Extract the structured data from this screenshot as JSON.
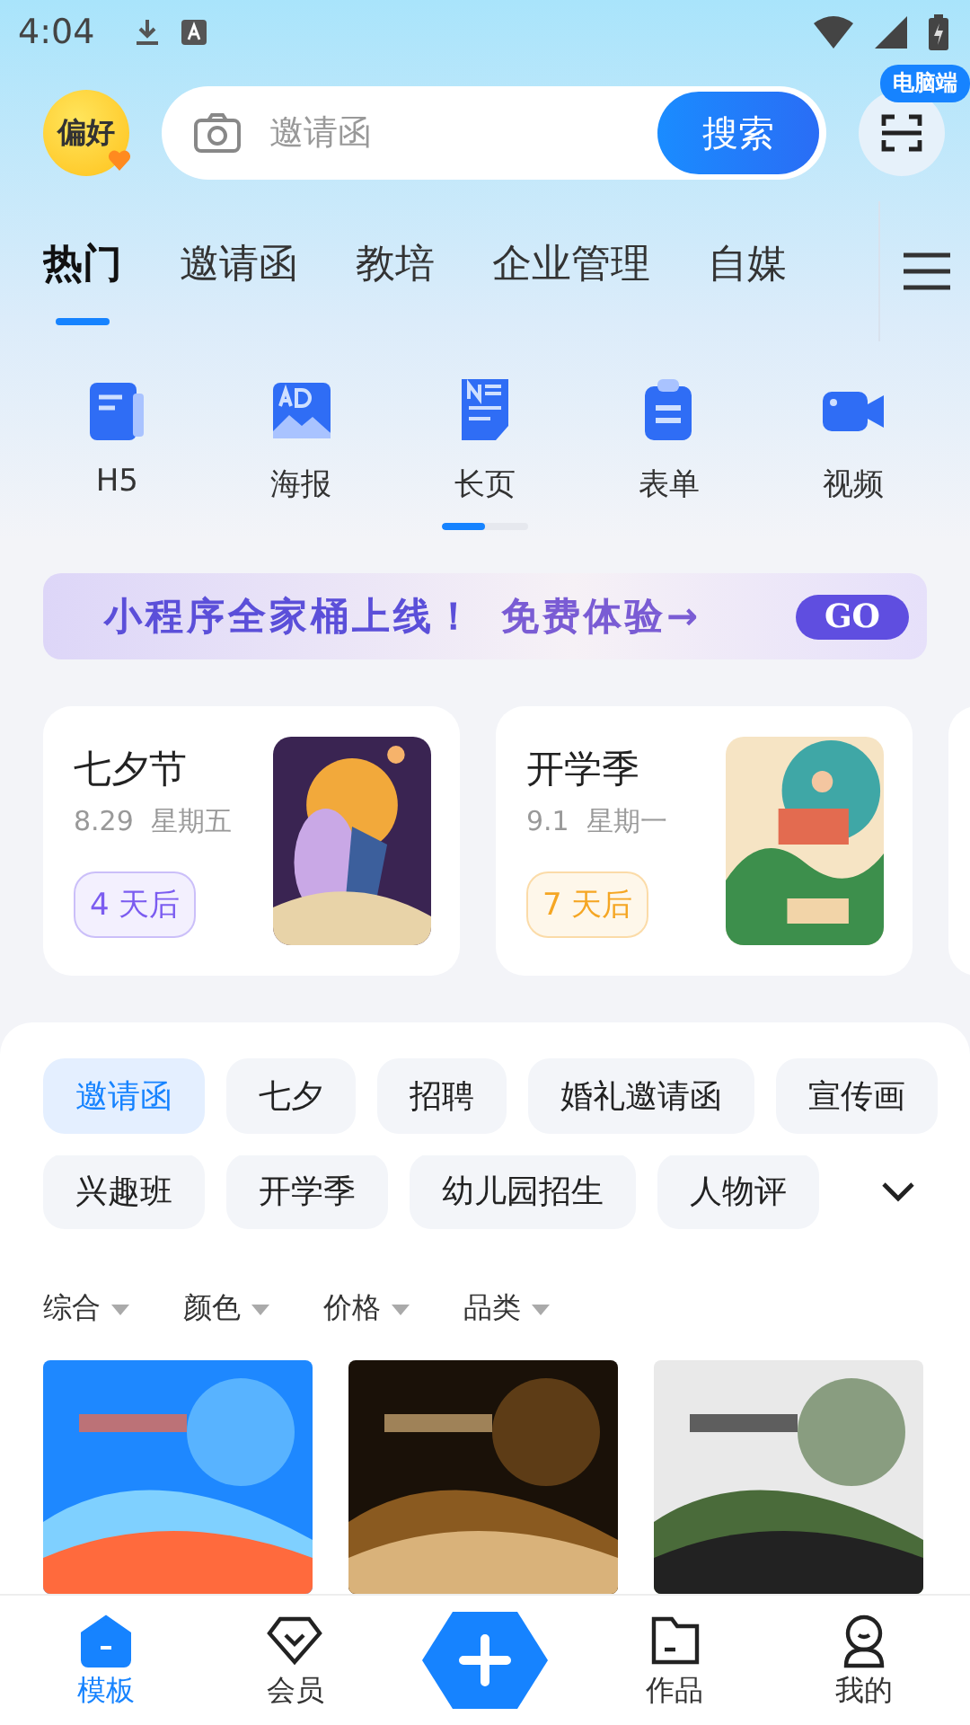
{
  "status_bar": {
    "time": "4:04"
  },
  "header": {
    "avatar_label": "偏好",
    "search": {
      "placeholder": "邀请函",
      "button": "搜索"
    },
    "pc_badge": "电脑端"
  },
  "tabs": [
    {
      "label": "热门",
      "selected": true
    },
    {
      "label": "邀请函",
      "selected": false
    },
    {
      "label": "教培",
      "selected": false
    },
    {
      "label": "企业管理",
      "selected": false
    },
    {
      "label": "自媒",
      "selected": false
    }
  ],
  "types": [
    {
      "kind": "h5",
      "label": "H5"
    },
    {
      "kind": "poster",
      "label": "海报"
    },
    {
      "kind": "longpage",
      "label": "长页"
    },
    {
      "kind": "form",
      "label": "表单"
    },
    {
      "kind": "video",
      "label": "视频"
    }
  ],
  "types_pager": {
    "level": 0.5
  },
  "banner": {
    "text": "小程序全家桶上线！",
    "cta": "免费体验→",
    "button": "GO"
  },
  "events": [
    {
      "title": "七夕节",
      "date": "8.29",
      "weekday": "星期五",
      "countdown": "4 天后",
      "color": "#7b5cf0"
    },
    {
      "title": "开学季",
      "date": "9.1",
      "weekday": "星期一",
      "countdown": "7 天后",
      "color": "#f5a623"
    }
  ],
  "chips": [
    [
      {
        "label": "邀请函",
        "selected": true
      },
      {
        "label": "七夕",
        "selected": false
      },
      {
        "label": "招聘",
        "selected": false
      },
      {
        "label": "婚礼邀请函",
        "selected": false
      },
      {
        "label": "宣传画",
        "selected": false
      }
    ],
    [
      {
        "label": "兴趣班",
        "selected": false
      },
      {
        "label": "开学季",
        "selected": false
      },
      {
        "label": "幼儿园招生",
        "selected": false
      },
      {
        "label": "人物评",
        "selected": false
      }
    ]
  ],
  "filters": [
    "综合",
    "颜色",
    "价格",
    "品类"
  ],
  "templates": [
    {
      "kind": "picture"
    },
    {
      "kind": "picture"
    },
    {
      "kind": "picture"
    }
  ],
  "nav": [
    {
      "kind": "home",
      "label": "模板",
      "selected": true
    },
    {
      "kind": "vip",
      "label": "会员",
      "selected": false
    },
    {
      "kind": "add"
    },
    {
      "kind": "works",
      "label": "作品",
      "selected": false
    },
    {
      "kind": "me",
      "label": "我的",
      "selected": false
    }
  ]
}
